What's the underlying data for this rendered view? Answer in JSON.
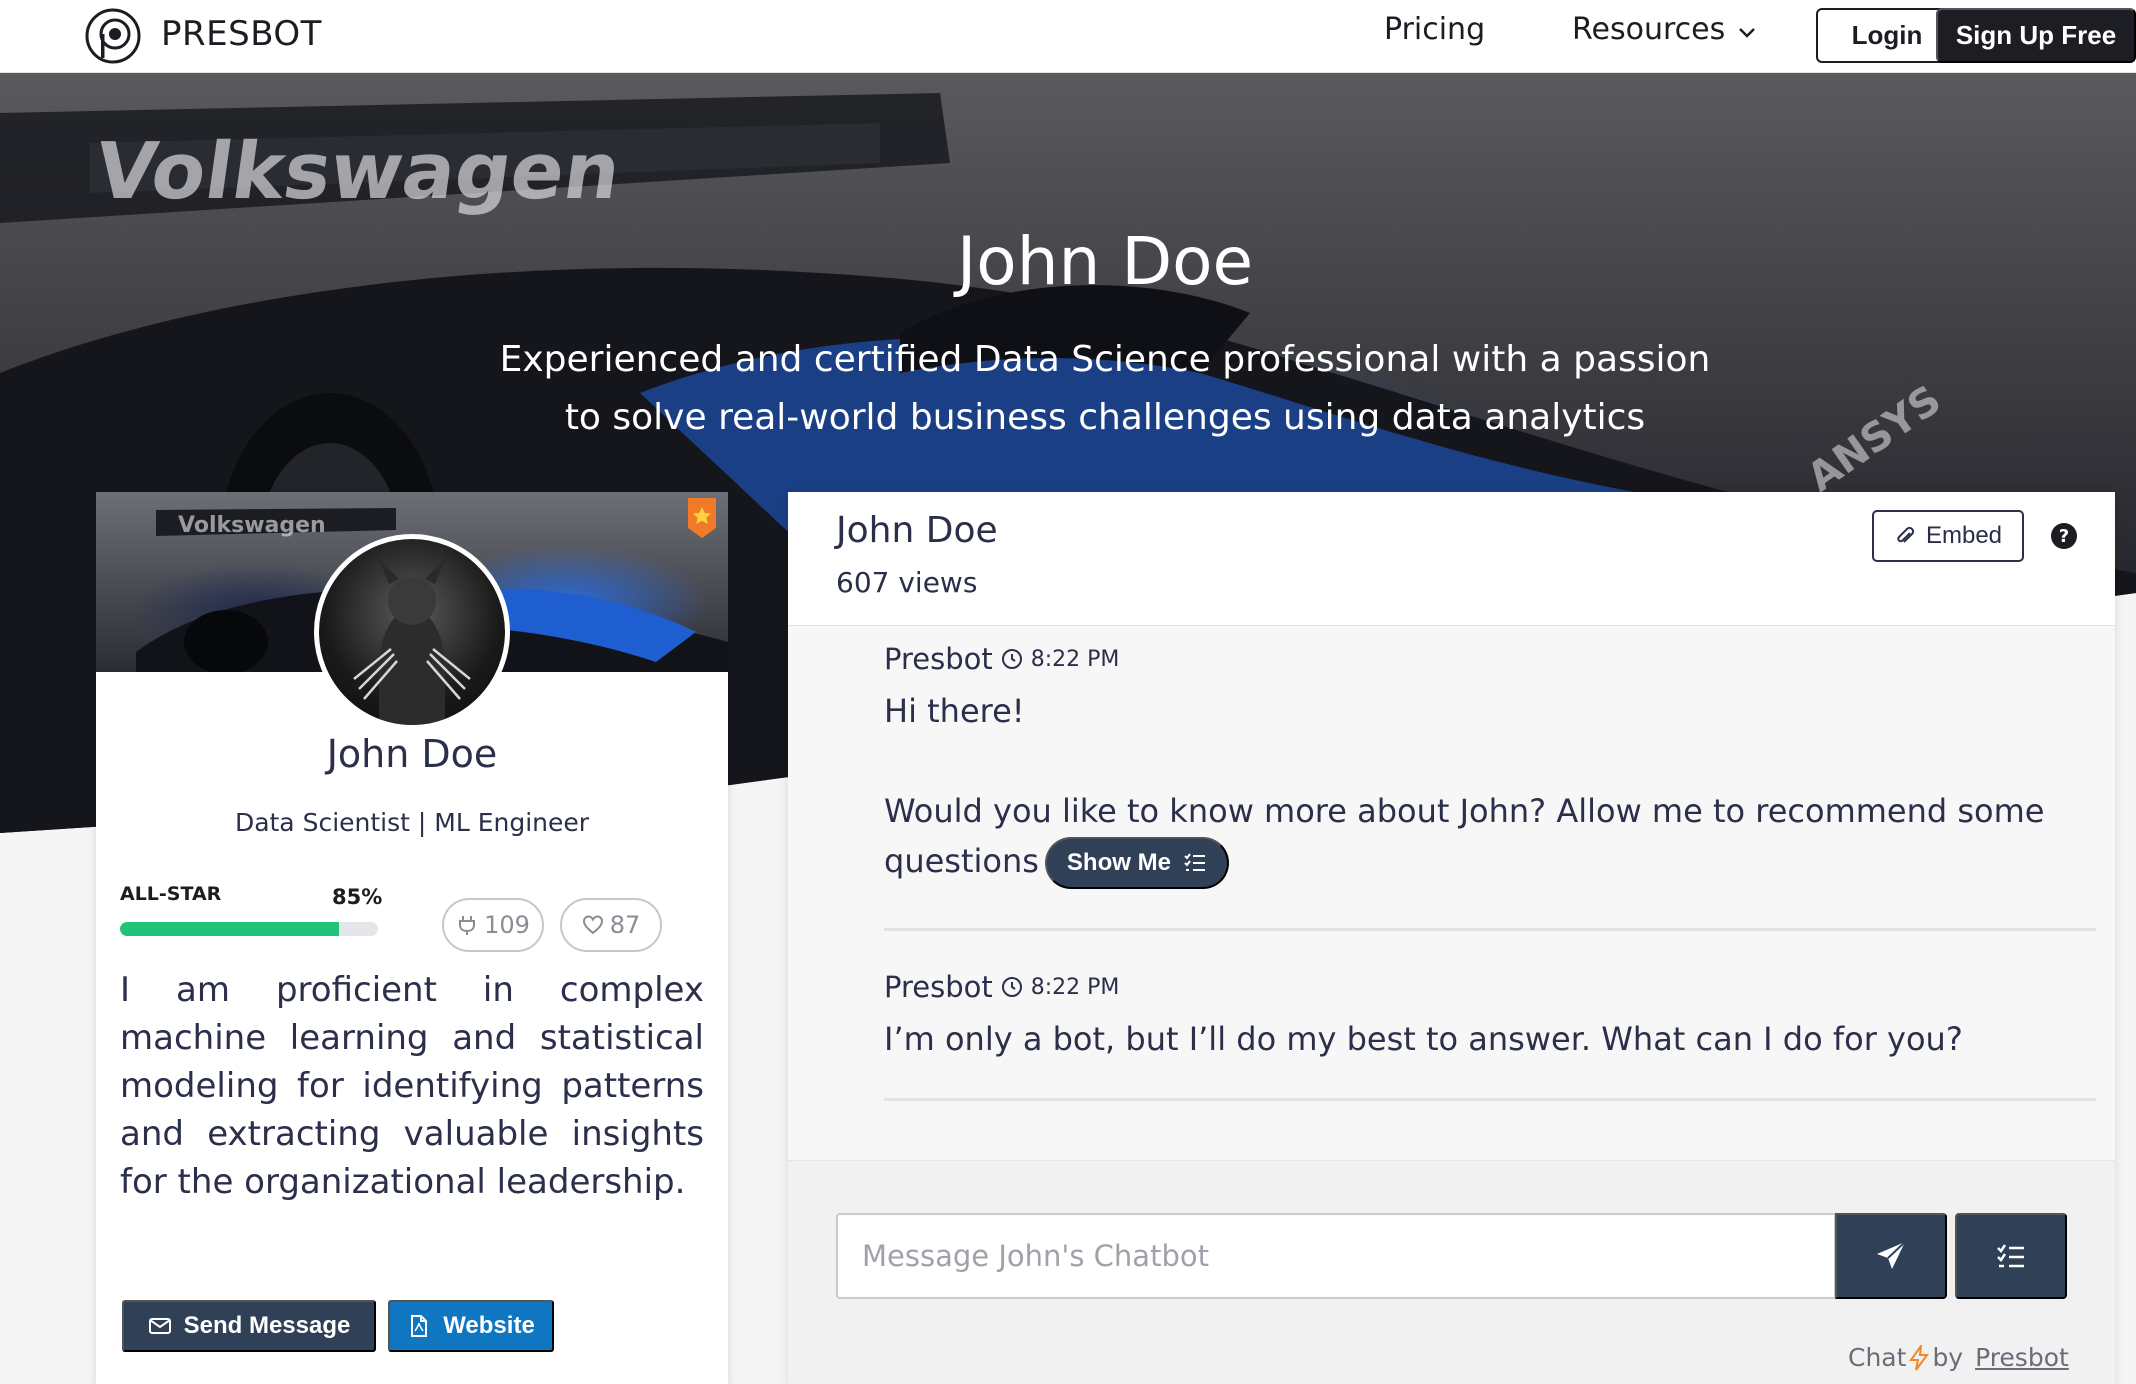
{
  "nav": {
    "brand": "PRESBOT",
    "links": [
      {
        "label": "Pricing"
      },
      {
        "label": "Resources"
      }
    ],
    "login_label": "Login",
    "signup_label": "Sign Up Free"
  },
  "hero": {
    "title": "John Doe",
    "subtitle": "Experienced and certified Data Science professional with a passion to solve real-world business challenges using data analytics"
  },
  "profile": {
    "name": "John Doe",
    "title": "Data Scientist | ML Engineer",
    "allstar_label": "ALL-STAR",
    "allstar_pct": "85%",
    "allstar_value": 0.85,
    "plug_count": "109",
    "like_count": "87",
    "bio": "I am proficient in complex machine learning and statistical modeling for identifying patterns and extracting valuable insights for the organizational leadership.",
    "send_message_label": "Send Message",
    "website_label": "Website"
  },
  "chat": {
    "name": "John Doe",
    "views": "607 views",
    "embed_label": "Embed",
    "messages": [
      {
        "sender": "Presbot",
        "time": "8:22 PM",
        "line1": "Hi there!",
        "line2": "Would you like to know more about John? Allow me to recommend some questions",
        "action_label": "Show Me"
      },
      {
        "sender": "Presbot",
        "time": "8:22 PM",
        "line1": "I’m only a bot, but I’ll do my best to answer. What can I do for you?"
      }
    ],
    "input_placeholder": "Message John's Chatbot",
    "footer_chat": "Chat",
    "footer_by": "by",
    "footer_link": "Presbot"
  },
  "colors": {
    "accent_dark": "#2f4057",
    "accent_blue": "#0f76c1",
    "progress_green": "#22c27a",
    "signup_bg": "#1d1e24",
    "text_primary": "#2b2f4a"
  },
  "icons": {
    "logo": "presbot-logo-icon",
    "chevron": "chevron-down-icon",
    "badge": "award-badge-icon",
    "plug": "plug-icon",
    "heart": "heart-icon",
    "mail": "mail-icon",
    "pdf": "file-pdf-icon",
    "paperclip": "paperclip-icon",
    "help": "help-circle-icon",
    "clock": "clock-icon",
    "list": "list-check-icon",
    "send": "paper-plane-icon",
    "bolt": "bolt-icon"
  }
}
